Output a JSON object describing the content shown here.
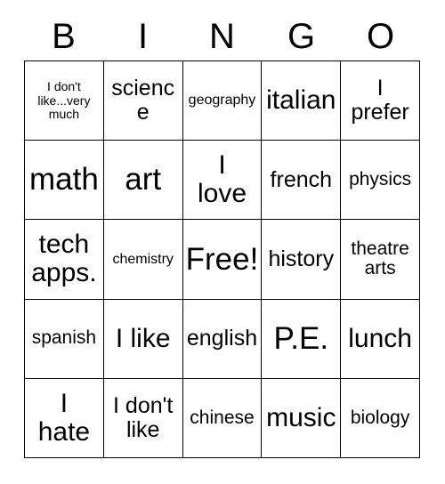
{
  "header": {
    "letters": [
      "B",
      "I",
      "N",
      "G",
      "O"
    ]
  },
  "grid": {
    "rows": 5,
    "columns": 5,
    "cells": [
      {
        "text": "I don't\nlike...very\nmuch",
        "size": "fs-xxs"
      },
      {
        "text": "science",
        "size": "fs-md"
      },
      {
        "text": "geography",
        "size": "fs-xs"
      },
      {
        "text": "italian",
        "size": "fs-lg"
      },
      {
        "text": "I\nprefer",
        "size": "fs-md"
      },
      {
        "text": "math",
        "size": "fs-xl"
      },
      {
        "text": "art",
        "size": "fs-xl"
      },
      {
        "text": "I\nlove",
        "size": "fs-lg"
      },
      {
        "text": "french",
        "size": "fs-md"
      },
      {
        "text": "physics",
        "size": "fs-sm"
      },
      {
        "text": "tech\napps.",
        "size": "fs-lg"
      },
      {
        "text": "chemistry",
        "size": "fs-xs"
      },
      {
        "text": "Free!",
        "size": "fs-xl"
      },
      {
        "text": "history",
        "size": "fs-md"
      },
      {
        "text": "theatre\narts",
        "size": "fs-sm"
      },
      {
        "text": "spanish",
        "size": "fs-sm"
      },
      {
        "text": "I like",
        "size": "fs-lg"
      },
      {
        "text": "english",
        "size": "fs-md"
      },
      {
        "text": "P.E.",
        "size": "fs-xl"
      },
      {
        "text": "lunch",
        "size": "fs-lg"
      },
      {
        "text": "I\nhate",
        "size": "fs-lg"
      },
      {
        "text": "I don't\nlike",
        "size": "fs-md"
      },
      {
        "text": "chinese",
        "size": "fs-sm"
      },
      {
        "text": "music",
        "size": "fs-lg"
      },
      {
        "text": "biology",
        "size": "fs-sm"
      }
    ]
  },
  "colors": {
    "background": "#ffffff",
    "text": "#000000",
    "gridline": "#000000"
  }
}
